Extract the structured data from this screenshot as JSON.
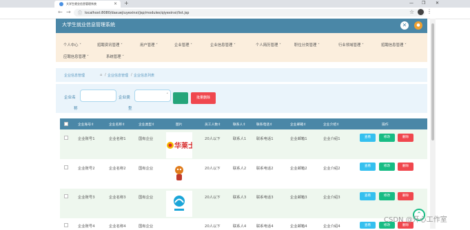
{
  "browser": {
    "tab_title": "大学生就业信息管理系统",
    "url": "localhost:8080/daxuejiuyexinxi/jsp/modules/qiyexinxi/list.jsp",
    "new_tab": "+",
    "close_tab": "×",
    "back": "←",
    "forward": "→",
    "reload": "C",
    "win_min": "—",
    "win_max": "❐",
    "win_close": "✕"
  },
  "header": {
    "title": "大学生就业信息管理系统"
  },
  "menu": {
    "row1": [
      "个人中心",
      "招聘资讯管理",
      "用户管理",
      "企业管理",
      "企业信息管理",
      "个人简历管理",
      "职位分类管理",
      "行业领域管理",
      "招聘信息管理"
    ],
    "row2": [
      "应聘信息管理",
      "系统管理"
    ]
  },
  "breadcrumb": {
    "root": "企业信息管理",
    "sep": "/",
    "level1": "企业信息管理",
    "level2": "企业信息列表"
  },
  "search": {
    "name_label_1": "企业名",
    "name_label_2": "称",
    "type_label_1": "企业类",
    "type_label_2": "型",
    "batch_delete": "批量删除"
  },
  "table": {
    "columns": [
      "企业账号",
      "企业名称",
      "企业类型",
      "图片",
      "员工人数",
      "联系人",
      "联系电话",
      "企业邮箱",
      "企业介绍",
      "操作"
    ],
    "rows": [
      {
        "account": "企业账号1",
        "name": "企业名称1",
        "type": "国有企业",
        "staff": "20人以下",
        "contact": "联系人1",
        "phone": "联系电话1",
        "email": "企业邮箱1",
        "intro": "企业介绍1",
        "logo": "华莱士"
      },
      {
        "account": "企业账号2",
        "name": "企业名称2",
        "type": "国有企业",
        "staff": "20人以下",
        "contact": "联系人2",
        "phone": "联系电话2",
        "email": "企业邮箱2",
        "intro": "企业介绍2",
        "logo": ""
      },
      {
        "account": "企业账号3",
        "name": "企业名称3",
        "type": "国有企业",
        "staff": "20人以下",
        "contact": "联系人3",
        "phone": "联系电话3",
        "email": "企业邮箱3",
        "intro": "企业介绍3",
        "logo": ""
      },
      {
        "account": "企业账号4",
        "name": "企业名称4",
        "type": "国有企业",
        "staff": "20人以下",
        "contact": "联系人4",
        "phone": "联系电话4",
        "email": "企业邮箱4",
        "intro": "企业介绍4",
        "logo": ""
      }
    ],
    "actions": {
      "view": "查看",
      "edit": "修改",
      "delete": "删除"
    }
  },
  "watermark": "CSDN @开心工作室"
}
